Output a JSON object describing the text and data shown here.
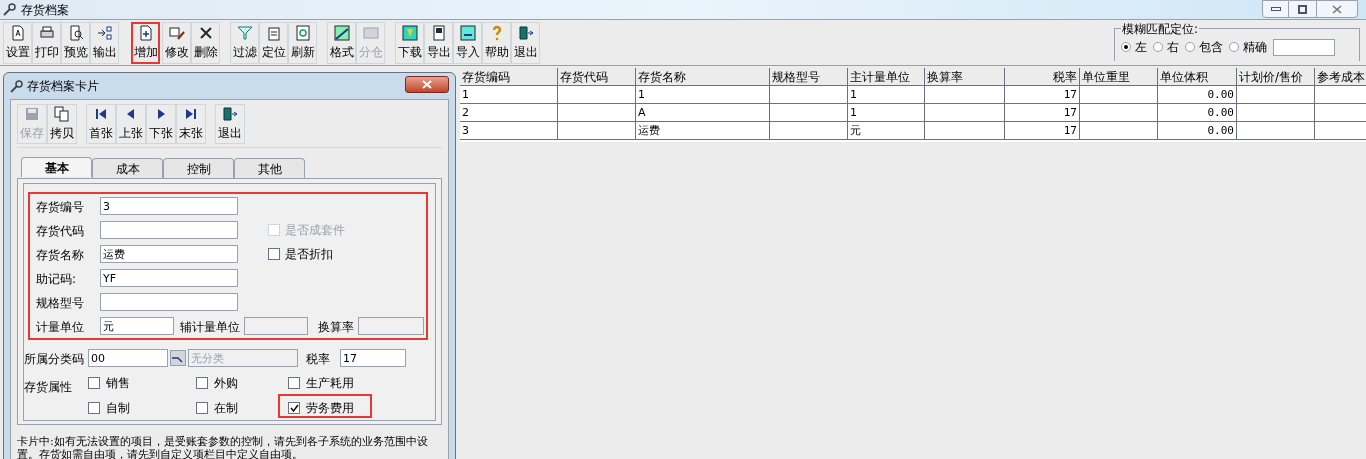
{
  "window": {
    "title": "存货档案"
  },
  "toolbar": [
    {
      "label": "设置",
      "disabled": false,
      "highlighted": false
    },
    {
      "label": "打印",
      "disabled": false,
      "highlighted": false
    },
    {
      "label": "预览",
      "disabled": false,
      "highlighted": false
    },
    {
      "label": "输出",
      "disabled": false,
      "highlighted": false
    },
    {
      "label": "增加",
      "disabled": false,
      "highlighted": true
    },
    {
      "label": "修改",
      "disabled": false,
      "highlighted": false
    },
    {
      "label": "删除",
      "disabled": false,
      "highlighted": false
    },
    {
      "label": "过滤",
      "disabled": false,
      "highlighted": false
    },
    {
      "label": "定位",
      "disabled": false,
      "highlighted": false
    },
    {
      "label": "刷新",
      "disabled": false,
      "highlighted": false
    },
    {
      "label": "格式",
      "disabled": false,
      "highlighted": false
    },
    {
      "label": "分仓",
      "disabled": true,
      "highlighted": false
    },
    {
      "label": "下载",
      "disabled": false,
      "highlighted": false
    },
    {
      "label": "导出",
      "disabled": false,
      "highlighted": false
    },
    {
      "label": "导入",
      "disabled": false,
      "highlighted": false
    },
    {
      "label": "帮助",
      "disabled": false,
      "highlighted": false
    },
    {
      "label": "退出",
      "disabled": false,
      "highlighted": false
    }
  ],
  "fuzzy_match": {
    "title": "模糊匹配定位:",
    "options": [
      {
        "label": "左",
        "selected": true
      },
      {
        "label": "右",
        "selected": false
      },
      {
        "label": "包含",
        "selected": false
      },
      {
        "label": "精确",
        "selected": false
      }
    ]
  },
  "table": {
    "columns": [
      "存货编码",
      "存货代码",
      "存货名称",
      "规格型号",
      "主计量单位",
      "换算率",
      "税率",
      "单位重里",
      "单位体积",
      "计划价/售价",
      "参考成本"
    ],
    "rows": [
      [
        "1",
        null,
        "1",
        null,
        "1",
        null,
        "17",
        null,
        "0.00",
        null,
        null
      ],
      [
        "2",
        null,
        "A",
        null,
        "1",
        null,
        "17",
        null,
        "0.00",
        null,
        null
      ],
      [
        "3",
        null,
        "运费",
        null,
        "元",
        null,
        "17",
        null,
        "0.00",
        null,
        null
      ]
    ]
  },
  "dialog": {
    "title": "存货档案卡片",
    "toolbar": [
      {
        "label": "保存",
        "disabled": true
      },
      {
        "label": "拷贝",
        "disabled": false
      },
      {
        "label": "首张",
        "disabled": false
      },
      {
        "label": "上张",
        "disabled": false
      },
      {
        "label": "下张",
        "disabled": false
      },
      {
        "label": "末张",
        "disabled": false
      },
      {
        "label": "退出",
        "disabled": false
      }
    ],
    "tabs": [
      {
        "label": "基本",
        "selected": true
      },
      {
        "label": "成本",
        "selected": false
      },
      {
        "label": "控制",
        "selected": false
      },
      {
        "label": "其他",
        "selected": false
      }
    ],
    "fields": {
      "code": {
        "label": "存货编号",
        "value": "3"
      },
      "alias": {
        "label": "存货代码"
      },
      "name": {
        "label": "存货名称",
        "value": "运费"
      },
      "mnemonic": {
        "label": "助记码:",
        "value": "YF"
      },
      "spec": {
        "label": "规格型号"
      },
      "unit": {
        "label": "计量单位",
        "value": "元"
      },
      "aux_unit": {
        "label": "辅计量单位"
      },
      "rate": {
        "label": "换算率"
      },
      "category": {
        "label": "所属分类码",
        "value": "00",
        "name": "无分类"
      },
      "tax": {
        "label": "税率",
        "value": "17"
      }
    },
    "kit": {
      "label": "是否成套件",
      "checked": false,
      "disabled": true
    },
    "discount": {
      "label": "是否折扣",
      "checked": false,
      "disabled": false
    },
    "attributes_label": "存货属性",
    "attributes": [
      {
        "label": "销售",
        "checked": false
      },
      {
        "label": "外购",
        "checked": false
      },
      {
        "label": "生产耗用",
        "checked": false
      },
      {
        "label": "自制",
        "checked": false
      },
      {
        "label": "在制",
        "checked": false
      },
      {
        "label": "劳务费用",
        "checked": true
      }
    ],
    "note": "卡片中:如有无法设置的项目，是受账套参数的控制，请先到各子系统的业务范围中设置。存货如需自由项，请先到自定义项栏目中定义自由项。"
  }
}
